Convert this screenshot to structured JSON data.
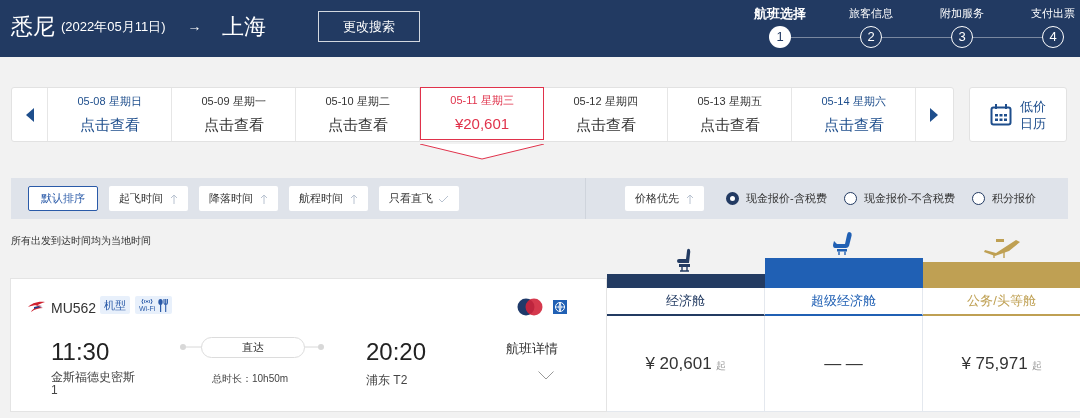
{
  "header": {
    "origin": "悉尼",
    "date": "(2022年05月11日)",
    "arrow": "→",
    "destination": "上海",
    "change_button": "更改搜索"
  },
  "steps": [
    {
      "label": "航班选择",
      "number": "1",
      "selected": true
    },
    {
      "label": "旅客信息",
      "number": "2",
      "selected": false
    },
    {
      "label": "附加服务",
      "number": "3",
      "selected": false
    },
    {
      "label": "支付出票",
      "number": "4",
      "selected": false
    }
  ],
  "dates": [
    {
      "date": "05-08 星期日",
      "price": "点击查看",
      "weekend": true,
      "selected": false
    },
    {
      "date": "05-09 星期一",
      "price": "点击查看",
      "weekend": false,
      "selected": false
    },
    {
      "date": "05-10 星期二",
      "price": "点击查看",
      "weekend": false,
      "selected": false
    },
    {
      "date": "05-11 星期三",
      "price": "¥20,601",
      "selected": true
    },
    {
      "date": "05-12 星期四",
      "price": "点击查看",
      "weekend": false,
      "selected": false
    },
    {
      "date": "05-13 星期五",
      "price": "点击查看",
      "weekend": false,
      "selected": false
    },
    {
      "date": "05-14 星期六",
      "price": "点击查看",
      "weekend": true,
      "selected": false
    }
  ],
  "calendar_button": [
    "低价",
    "日历"
  ],
  "sort_buttons": [
    {
      "label": "默认排序",
      "kind": "plain",
      "selected": true
    },
    {
      "label": "起飞时间",
      "kind": "arrow",
      "selected": false
    },
    {
      "label": "降落时间",
      "kind": "arrow",
      "selected": false
    },
    {
      "label": "航程时间",
      "kind": "arrow",
      "selected": false
    },
    {
      "label": "只看直飞",
      "kind": "check",
      "selected": false
    }
  ],
  "price_sort": "价格优先",
  "price_options": [
    {
      "label": "现金报价-含税费",
      "selected": true
    },
    {
      "label": "现金报价-不含税费",
      "selected": false
    },
    {
      "label": "积分报价",
      "selected": false
    }
  ],
  "note": "所有出发到达时间均为当地时间",
  "flight": {
    "number": "MU562",
    "aircraft_tag": "机型",
    "wifi_label": "Wi-Fi",
    "depart_time": "11:30",
    "depart_airport": "金斯福德史密斯\n1",
    "stop_label": "直达",
    "duration": "总时长：10h50m",
    "arrive_time": "20:20",
    "arrive_airport": "浦东 T2",
    "details": "航班详情"
  },
  "cabins": [
    {
      "name": "经济舱",
      "color": "#233b62",
      "kind": "seat",
      "price": "¥ 20,601",
      "suffix": "起"
    },
    {
      "name": "超级经济舱",
      "color": "#2060b4",
      "kind": "recline",
      "price": "— —"
    },
    {
      "name": "公务/头等舱",
      "color": "#bfa053",
      "kind": "flat",
      "price": "¥ 75,971",
      "suffix": "起"
    }
  ]
}
